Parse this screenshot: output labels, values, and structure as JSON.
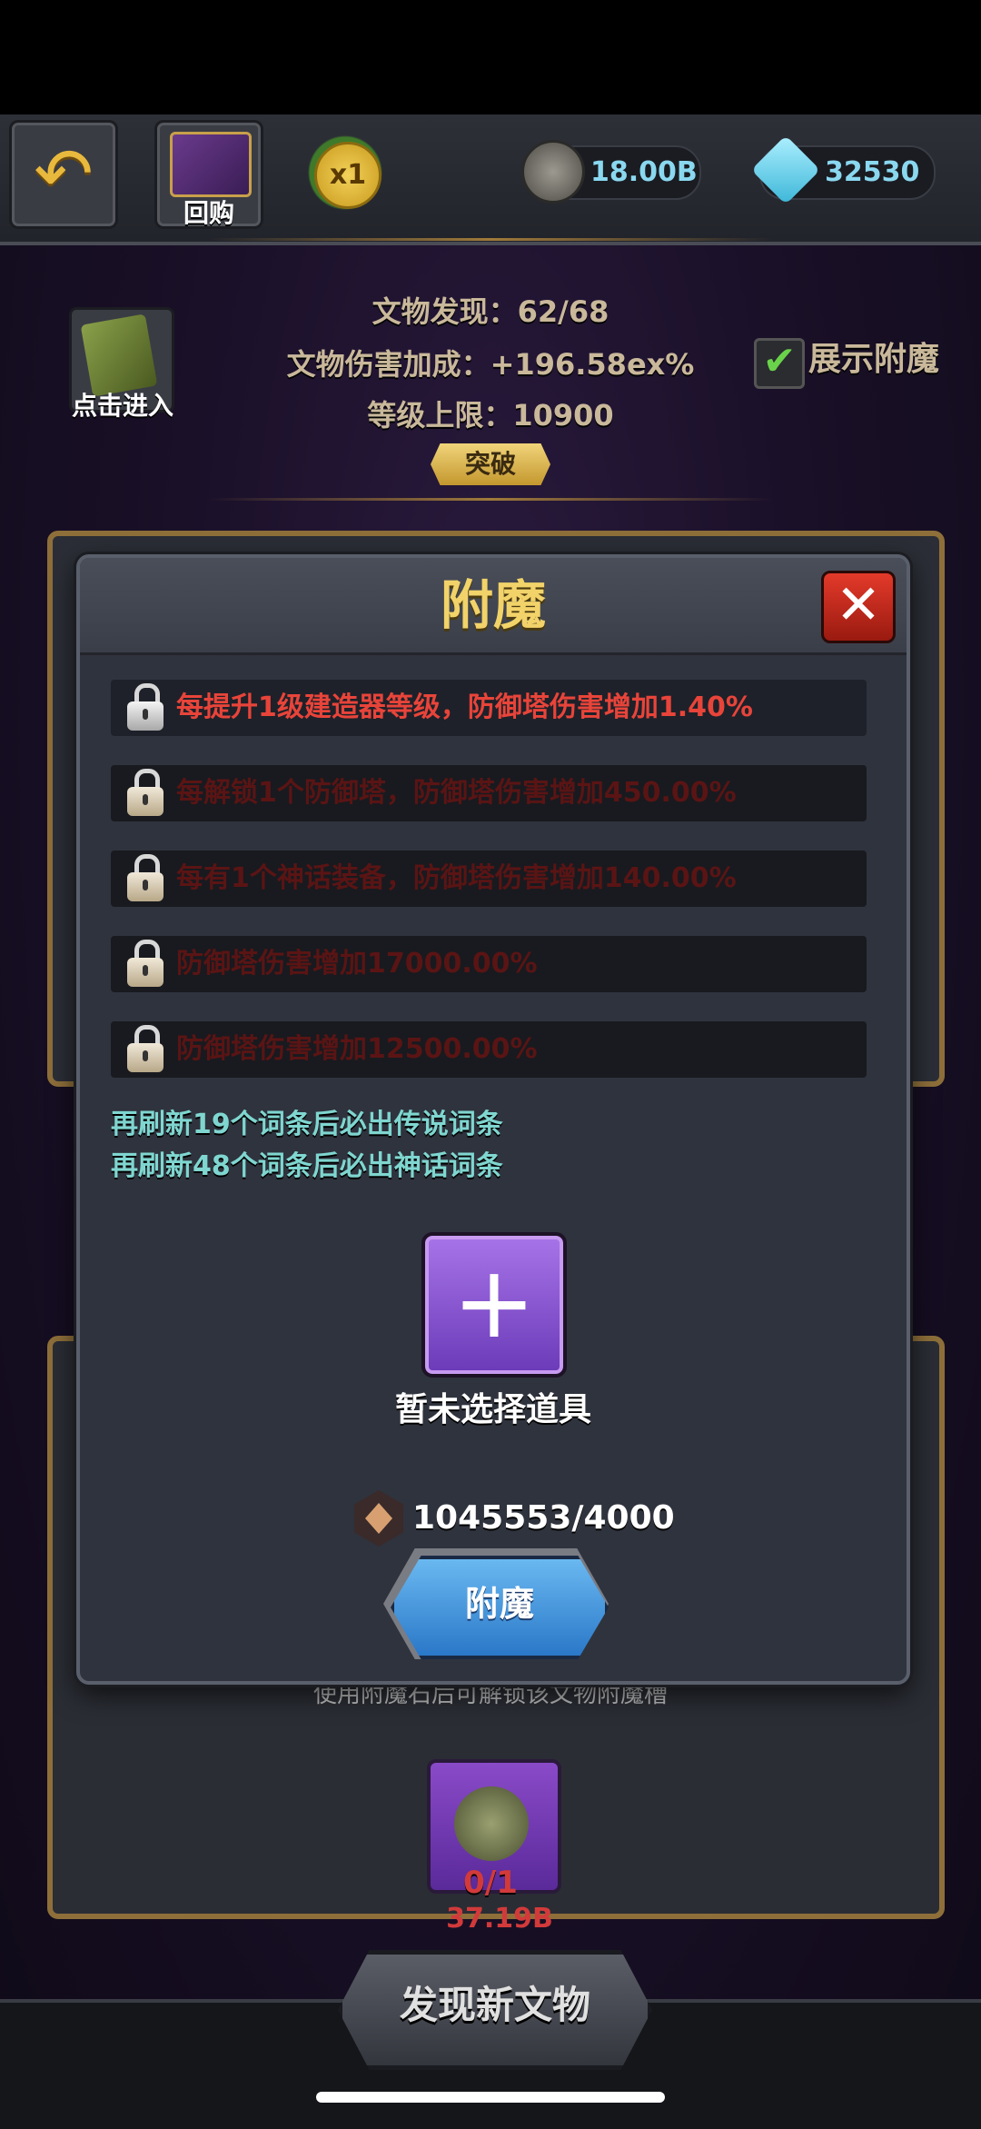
{
  "topbar": {
    "buyback_label": "回购",
    "speed_label": "x1",
    "gold_value": "18.00B",
    "gem_value": "32530"
  },
  "info": {
    "enter_label": "点击进入",
    "discovered": "文物发现：62/68",
    "damage_bonus": "文物伤害加成：+196.58ex%",
    "level_cap": "等级上限：10900",
    "breakthrough_label": "突破",
    "show_enchant_label": "展示附魔",
    "show_enchant_checked": true
  },
  "dialog": {
    "title": "附魔",
    "affixes": [
      {
        "text": "每提升1级建造器等级，防御塔伤害增加1.40%",
        "active": true
      },
      {
        "text": "每解锁1个防御塔，防御塔伤害增加450.00%",
        "active": false
      },
      {
        "text": "每有1个神话装备，防御塔伤害增加140.00%",
        "active": false
      },
      {
        "text": "防御塔伤害增加17000.00%",
        "active": false
      },
      {
        "text": "防御塔伤害增加12500.00%",
        "active": false
      }
    ],
    "hint_legend": "再刷新19个词条后必出传说词条",
    "hint_myth": "再刷新48个词条后必出神话词条",
    "no_item_label": "暂未选择道具",
    "cost": "1045553/4000",
    "enchant_button": "附魔"
  },
  "background": {
    "hint_text": "使用附魔石后可解锁该文物附魔槽",
    "slot_count": "0/1",
    "cost": "37.19B",
    "discover_button": "发现新文物"
  },
  "colors": {
    "title_gold": "#f2d36a",
    "active_affix": "#e8443a",
    "locked_affix": "#5a1414",
    "hint_cyan": "#7fd6d0"
  }
}
